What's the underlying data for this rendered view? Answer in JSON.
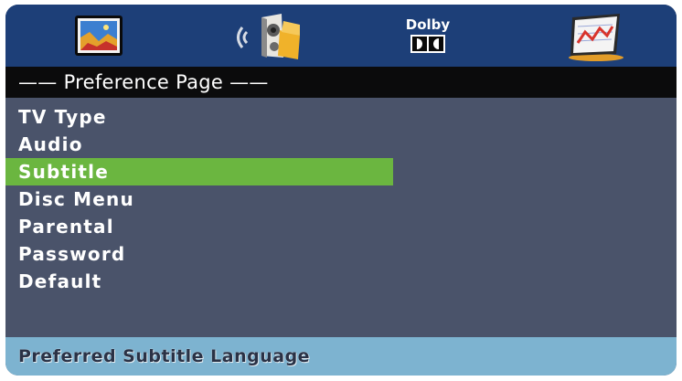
{
  "icon_bar": {
    "tabs": [
      {
        "id": "general",
        "icon": "tv-screen-icon"
      },
      {
        "id": "audio",
        "icon": "speaker-icon"
      },
      {
        "id": "dolby",
        "icon": "dolby-icon",
        "label": "Dolby"
      },
      {
        "id": "preference",
        "icon": "preference-chart-icon"
      }
    ]
  },
  "title": "—— Preference Page ——",
  "menu": {
    "items": [
      {
        "label": "TV Type"
      },
      {
        "label": "Audio"
      },
      {
        "label": "Subtitle"
      },
      {
        "label": "Disc Menu"
      },
      {
        "label": "Parental"
      },
      {
        "label": "Password"
      },
      {
        "label": "Default"
      }
    ],
    "selected_index": 2
  },
  "help_text": "Preferred Subtitle Language",
  "colors": {
    "background": "#4a536a",
    "icon_bar": "#1d3f78",
    "title_bar": "#0b0b0c",
    "highlight": "#6bb640",
    "help_bar": "#7db3d0"
  }
}
